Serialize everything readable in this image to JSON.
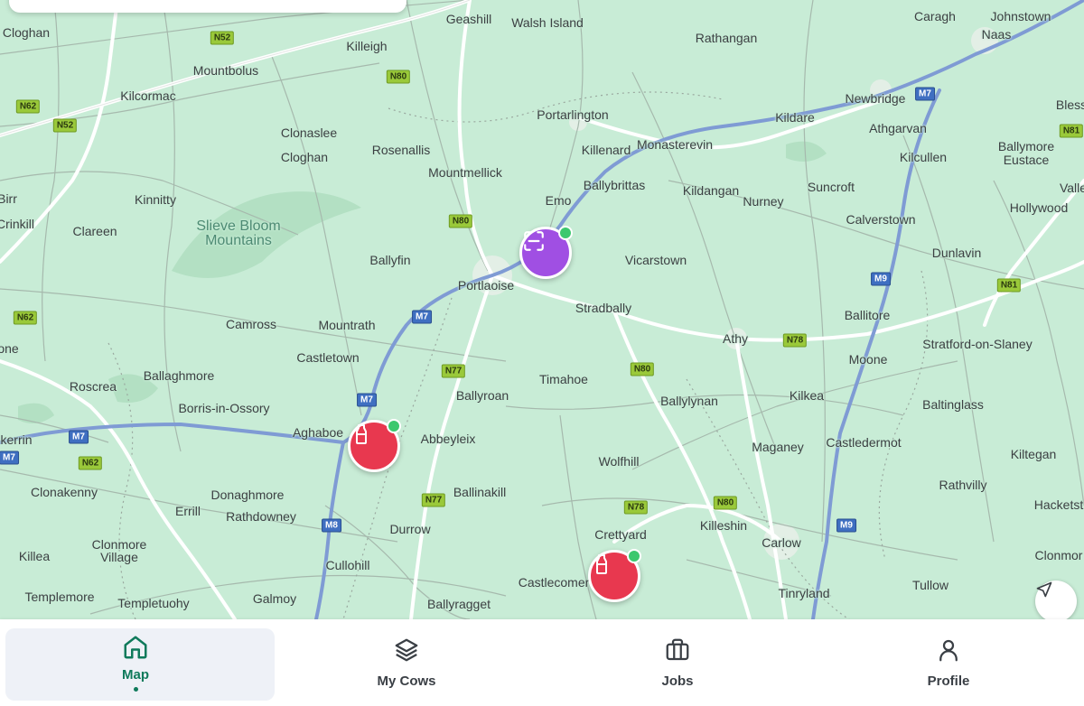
{
  "map": {
    "places": [
      {
        "id": "geashill",
        "label": "Geashill"
      },
      {
        "id": "walsh-island",
        "label": "Walsh Island"
      },
      {
        "id": "caragh",
        "label": "Caragh"
      },
      {
        "id": "johnstown",
        "label": "Johnstown"
      },
      {
        "id": "cloghan-nw",
        "label": "Cloghan"
      },
      {
        "id": "killeigh",
        "label": "Killeigh"
      },
      {
        "id": "rathangan",
        "label": "Rathangan"
      },
      {
        "id": "naas",
        "label": "Naas"
      },
      {
        "id": "mountbolus",
        "label": "Mountbolus"
      },
      {
        "id": "kilcormac",
        "label": "Kilcormac"
      },
      {
        "id": "newbridge",
        "label": "Newbridge"
      },
      {
        "id": "portarlington",
        "label": "Portarlington"
      },
      {
        "id": "kildare",
        "label": "Kildare"
      },
      {
        "id": "bless",
        "label": "Bless"
      },
      {
        "id": "athgarvan",
        "label": "Athgarvan"
      },
      {
        "id": "clonaslee",
        "label": "Clonaslee"
      },
      {
        "id": "rosenallis",
        "label": "Rosenallis"
      },
      {
        "id": "killenard",
        "label": "Killenard"
      },
      {
        "id": "monasterevin",
        "label": "Monasterevin"
      },
      {
        "id": "cloghan",
        "label": "Cloghan"
      },
      {
        "id": "kilcullen",
        "label": "Kilcullen"
      },
      {
        "id": "ballymore-eustace",
        "label": "Ballymore Eustace"
      },
      {
        "id": "mountmellick",
        "label": "Mountmellick"
      },
      {
        "id": "ballybrittas",
        "label": "Ballybrittas"
      },
      {
        "id": "birr",
        "label": "Birr"
      },
      {
        "id": "kinnitty",
        "label": "Kinnitty"
      },
      {
        "id": "kildangan",
        "label": "Kildangan"
      },
      {
        "id": "suncroft",
        "label": "Suncroft"
      },
      {
        "id": "valle",
        "label": "Valle"
      },
      {
        "id": "emo",
        "label": "Emo"
      },
      {
        "id": "nurney",
        "label": "Nurney"
      },
      {
        "id": "hollywood",
        "label": "Hollywood"
      },
      {
        "id": "crinkill",
        "label": "Crinkill"
      },
      {
        "id": "clareen",
        "label": "Clareen"
      },
      {
        "id": "calverstown",
        "label": "Calverstown"
      },
      {
        "id": "dunlavin",
        "label": "Dunlavin"
      },
      {
        "id": "ballyfin",
        "label": "Ballyfin"
      },
      {
        "id": "vicarstown",
        "label": "Vicarstown"
      },
      {
        "id": "portlaoise",
        "label": "Portlaoise"
      },
      {
        "id": "stradbally",
        "label": "Stradbally"
      },
      {
        "id": "ballitore",
        "label": "Ballitore"
      },
      {
        "id": "camross",
        "label": "Camross"
      },
      {
        "id": "mountrath",
        "label": "Mountrath"
      },
      {
        "id": "athy",
        "label": "Athy"
      },
      {
        "id": "stratford-on-slaney",
        "label": "Stratford-on-Slaney"
      },
      {
        "id": "one",
        "label": "one"
      },
      {
        "id": "castletown",
        "label": "Castletown"
      },
      {
        "id": "moone",
        "label": "Moone"
      },
      {
        "id": "ballaghmore",
        "label": "Ballaghmore"
      },
      {
        "id": "timahoe",
        "label": "Timahoe"
      },
      {
        "id": "roscrea",
        "label": "Roscrea"
      },
      {
        "id": "ballyroan",
        "label": "Ballyroan"
      },
      {
        "id": "kilkea",
        "label": "Kilkea"
      },
      {
        "id": "ballylynan",
        "label": "Ballylynan"
      },
      {
        "id": "baltinglass",
        "label": "Baltinglass"
      },
      {
        "id": "borris-in-ossory",
        "label": "Borris-in-Ossory"
      },
      {
        "id": "aghaboe",
        "label": "Aghaboe"
      },
      {
        "id": "abbeyleix",
        "label": "Abbeyleix"
      },
      {
        "id": "kerrin",
        "label": "kerrin"
      },
      {
        "id": "maganey",
        "label": "Maganey"
      },
      {
        "id": "castledermot",
        "label": "Castledermot"
      },
      {
        "id": "wolfhill",
        "label": "Wolfhill"
      },
      {
        "id": "kiltegan",
        "label": "Kiltegan"
      },
      {
        "id": "clonakenny",
        "label": "Clonakenny"
      },
      {
        "id": "donaghmore",
        "label": "Donaghmore"
      },
      {
        "id": "ballinakill",
        "label": "Ballinakill"
      },
      {
        "id": "rathvilly",
        "label": "Rathvilly"
      },
      {
        "id": "errill",
        "label": "Errill"
      },
      {
        "id": "rathdowney",
        "label": "Rathdowney"
      },
      {
        "id": "hacketstown",
        "label": "Hacketst"
      },
      {
        "id": "killeshin",
        "label": "Killeshin"
      },
      {
        "id": "durrow",
        "label": "Durrow"
      },
      {
        "id": "crettyard",
        "label": "Crettyard"
      },
      {
        "id": "carlow",
        "label": "Carlow"
      },
      {
        "id": "killea",
        "label": "Killea"
      },
      {
        "id": "clonmore-village",
        "label": "Clonmore\nVillage"
      },
      {
        "id": "clonmore",
        "label": "Clonmor"
      },
      {
        "id": "cullohill",
        "label": "Cullohill"
      },
      {
        "id": "castlecomer",
        "label": "Castlecomer"
      },
      {
        "id": "tullow",
        "label": "Tullow"
      },
      {
        "id": "templemore",
        "label": "Templemore"
      },
      {
        "id": "templetuohy",
        "label": "Templetuohy"
      },
      {
        "id": "galmoy",
        "label": "Galmoy"
      },
      {
        "id": "ballyragget",
        "label": "Ballyragget"
      },
      {
        "id": "tinryland",
        "label": "Tinryland"
      }
    ],
    "region_label": "Slieve Bloom\nMountains",
    "road_shields": [
      {
        "id": "n52-a",
        "label": "N52",
        "kind": "national"
      },
      {
        "id": "n80-a",
        "label": "N80",
        "kind": "national"
      },
      {
        "id": "n62-a",
        "label": "N62",
        "kind": "national"
      },
      {
        "id": "n52-b",
        "label": "N52",
        "kind": "national"
      },
      {
        "id": "m7-a",
        "label": "M7",
        "kind": "motorway"
      },
      {
        "id": "n81-a",
        "label": "N81",
        "kind": "national"
      },
      {
        "id": "n80-b",
        "label": "N80",
        "kind": "national"
      },
      {
        "id": "m9-a",
        "label": "M9",
        "kind": "motorway"
      },
      {
        "id": "n81-b",
        "label": "N81",
        "kind": "national"
      },
      {
        "id": "n62-b",
        "label": "N62",
        "kind": "national"
      },
      {
        "id": "m7-b",
        "label": "M7",
        "kind": "motorway"
      },
      {
        "id": "n78-a",
        "label": "N78",
        "kind": "national"
      },
      {
        "id": "n77-a",
        "label": "N77",
        "kind": "national"
      },
      {
        "id": "n80-c",
        "label": "N80",
        "kind": "national"
      },
      {
        "id": "m7-c",
        "label": "M7",
        "kind": "motorway"
      },
      {
        "id": "m7-d",
        "label": "M7",
        "kind": "motorway"
      },
      {
        "id": "m7-e",
        "label": "M7",
        "kind": "motorway"
      },
      {
        "id": "n62-c",
        "label": "N62",
        "kind": "national"
      },
      {
        "id": "n77-b",
        "label": "N77",
        "kind": "national"
      },
      {
        "id": "n78-b",
        "label": "N78",
        "kind": "national"
      },
      {
        "id": "n80-d",
        "label": "N80",
        "kind": "national"
      },
      {
        "id": "m8-a",
        "label": "M8",
        "kind": "motorway"
      },
      {
        "id": "m9-b",
        "label": "M9",
        "kind": "motorway"
      }
    ],
    "markers": [
      {
        "id": "scan-marker",
        "icon": "scan-icon",
        "color": "#a04fe3",
        "status_color": "#3cc86e"
      },
      {
        "id": "milk-marker-aghaboe",
        "icon": "milk-bottle-icon",
        "color": "#e8384f",
        "status_color": "#3cc86e"
      },
      {
        "id": "milk-marker-castlecomer",
        "icon": "milk-bottle-icon",
        "color": "#e8384f",
        "status_color": "#3cc86e"
      }
    ],
    "locate_button_icon": "navigation-arrow-icon"
  },
  "nav": {
    "items": [
      {
        "id": "map",
        "label": "Map",
        "icon": "home-icon",
        "active": true
      },
      {
        "id": "my-cows",
        "label": "My Cows",
        "icon": "layers-icon",
        "active": false
      },
      {
        "id": "jobs",
        "label": "Jobs",
        "icon": "briefcase-icon",
        "active": false
      },
      {
        "id": "profile",
        "label": "Profile",
        "icon": "user-icon",
        "active": false
      }
    ],
    "active_color": "#0f7a5b"
  },
  "colors": {
    "map_background": "#c8ecd6",
    "motorway": "#7f9bd4",
    "national_road": "#ffffff",
    "accent": "#0f7a5b"
  }
}
